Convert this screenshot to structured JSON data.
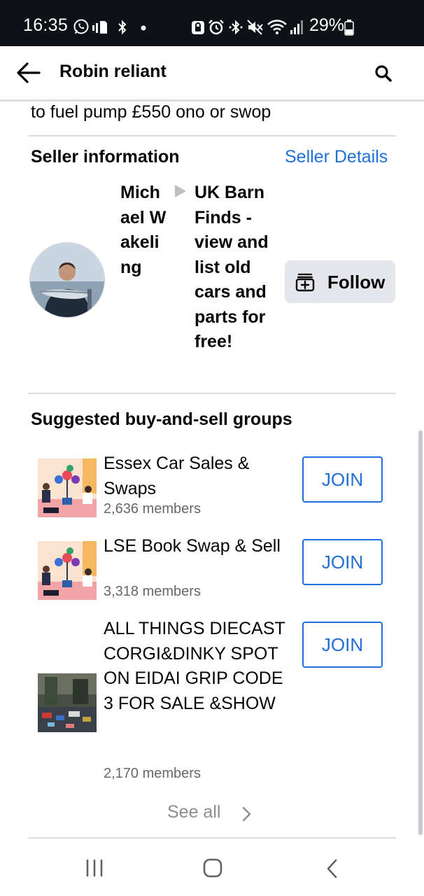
{
  "status_bar": {
    "time": "16:35",
    "battery": "29%"
  },
  "header": {
    "title": "Robin reliant"
  },
  "listing": {
    "description_tail": "to fuel pump £550 ono or swop"
  },
  "seller": {
    "heading": "Seller information",
    "details_link": "Seller Details",
    "name": "Michael Wakeling",
    "group": "UK Barn Finds - view and list old cars and parts for free!",
    "follow_label": "Follow"
  },
  "suggested": {
    "heading": "Suggested buy-and-sell groups",
    "groups": [
      {
        "name": "Essex Car Sales & Swaps",
        "members": "2,636 members",
        "join_label": "JOIN"
      },
      {
        "name": "LSE Book Swap & Sell",
        "members": "3,318 members",
        "join_label": "JOIN"
      },
      {
        "name": "ALL THINGS DIECAST CORGI&DINKY SPOT ON EIDAI GRIP CODE 3  FOR SALE &SHOW",
        "members": "2,170 members",
        "join_label": "JOIN"
      }
    ],
    "see_all": "See all"
  },
  "colors": {
    "link_blue": "#216fdb",
    "status_bar_bg": "#0e1116",
    "secondary_button_bg": "#e4e6eb",
    "muted_text": "#65676b"
  },
  "icons": [
    "back-arrow-icon",
    "search-icon",
    "follow-icon",
    "chevron-right-icon",
    "recent-apps-icon",
    "home-icon",
    "nav-back-icon"
  ]
}
